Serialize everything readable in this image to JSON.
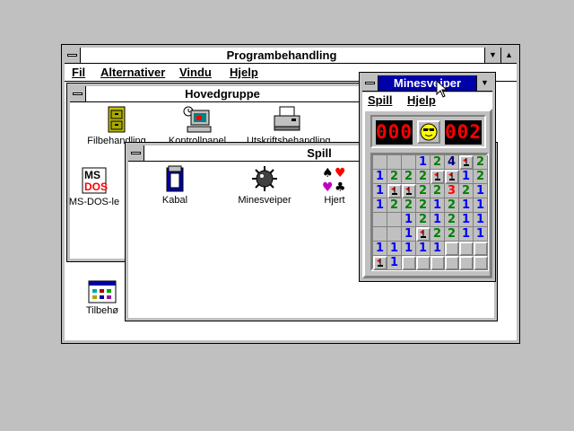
{
  "program_manager": {
    "title": "Programbehandling",
    "menu": [
      "Fil",
      "Alternativer",
      "Vindu",
      "Hjelp"
    ]
  },
  "hovedgruppe": {
    "title": "Hovedgruppe",
    "icons": [
      "Filbehandling",
      "Kontrollpanel",
      "Utskriftsbehandling",
      "MS-DOS-le"
    ]
  },
  "tilbehor": {
    "label": "Tilbehø"
  },
  "spill": {
    "title": "Spill",
    "icons": [
      "Kabal",
      "Minesveiper",
      "Hjert"
    ]
  },
  "minesweeper": {
    "title": "Minesveiper",
    "menu": [
      "Spill",
      "Hjelp"
    ],
    "mines_counter": "000",
    "timer": "002",
    "grid": [
      [
        "",
        "",
        "",
        "1",
        "2",
        "4",
        "F",
        "2"
      ],
      [
        "1",
        "2",
        "2",
        "2",
        "F",
        "F",
        "1",
        "2"
      ],
      [
        "1",
        "F",
        "F",
        "2",
        "2",
        "3",
        "2",
        "1"
      ],
      [
        "1",
        "2",
        "2",
        "2",
        "1",
        "2",
        "1",
        "1"
      ],
      [
        "",
        "",
        "1",
        "2",
        "1",
        "2",
        "1",
        "1"
      ],
      [
        "",
        "",
        "1",
        "F",
        "2",
        "2",
        "1",
        "1"
      ],
      [
        "1",
        "1",
        "1",
        "1",
        "1",
        "",
        "",
        ""
      ],
      [
        "F",
        "1",
        "",
        "",
        "",
        "",
        "",
        ""
      ]
    ]
  }
}
